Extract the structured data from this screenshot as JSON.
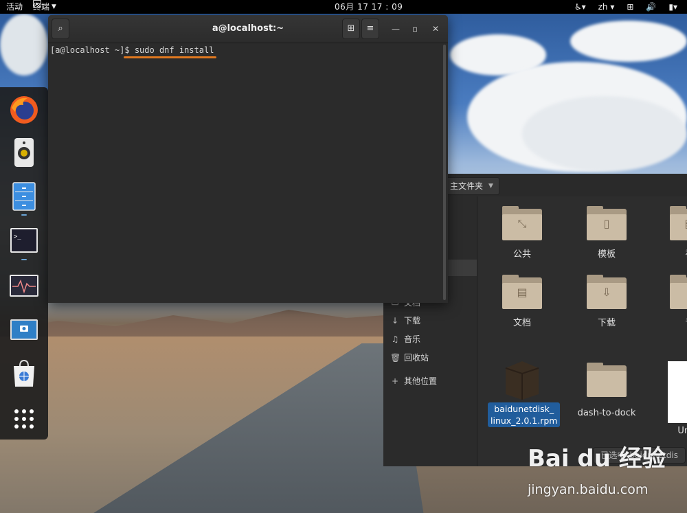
{
  "topbar": {
    "activities": "活动",
    "app_menu": "终端",
    "clock": "06月 17  17 : 09",
    "language": "zh"
  },
  "dock": {
    "items": [
      {
        "name": "firefox",
        "running": false
      },
      {
        "name": "rhythmbox",
        "running": false
      },
      {
        "name": "files",
        "running": true
      },
      {
        "name": "terminal",
        "running": true
      },
      {
        "name": "system-monitor",
        "running": false
      },
      {
        "name": "screenshot",
        "running": false
      },
      {
        "name": "software",
        "running": false
      },
      {
        "name": "show-applications",
        "running": false
      }
    ]
  },
  "terminal": {
    "title": "a@localhost:~",
    "prompt": "[a@localhost ~]$ ",
    "command": "sudo dnf install",
    "accent_underline": "#e0781f"
  },
  "files": {
    "path_label": "主文件夹",
    "sidebar": [
      {
        "icon": "document-icon",
        "label": "文档"
      },
      {
        "icon": "download-icon",
        "label": "下载"
      },
      {
        "icon": "music-icon",
        "label": "音乐"
      },
      {
        "icon": "trash-icon",
        "label": "回收站"
      },
      {
        "icon": "plus-icon",
        "label": "其他位置"
      }
    ],
    "items": [
      {
        "label": "公共",
        "icon": "share-icon"
      },
      {
        "label": "模板",
        "icon": "template-icon"
      },
      {
        "label": "视",
        "icon": "video-icon"
      },
      {
        "label": "文档",
        "icon": "document-icon"
      },
      {
        "label": "下载",
        "icon": "download-icon"
      },
      {
        "label": "音",
        "icon": "music-icon"
      },
      {
        "label": "baidunetdisk_linux_2.0.1.rpm",
        "label_line1": "baidunetdisk_",
        "label_line2": "linux_2.0.1.rpm",
        "icon": "package-icon",
        "selected": true
      },
      {
        "label": "dash-to-dock",
        "icon": "folder-icon"
      },
      {
        "label": "Untitl",
        "icon": "file-icon"
      }
    ],
    "status": "已选中“baidunetdis"
  },
  "watermark": {
    "logo": "Bai du 经验",
    "url": "jingyan.baidu.com"
  }
}
